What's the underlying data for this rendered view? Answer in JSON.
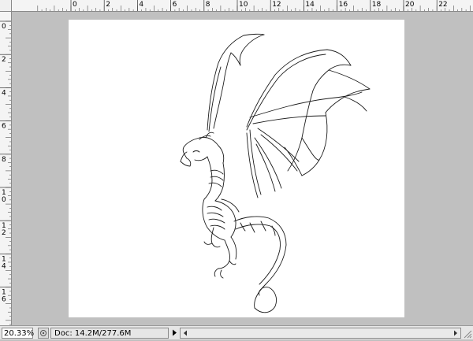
{
  "rulers": {
    "top_labels": [
      "0",
      "2",
      "4",
      "6",
      "8",
      "10",
      "12",
      "14",
      "16",
      "18",
      "20",
      "22"
    ],
    "left_labels": [
      "0",
      "2",
      "4",
      "6",
      "8",
      "10",
      "12",
      "14",
      "16"
    ]
  },
  "status_bar": {
    "zoom": "20.33%",
    "doc_info": "Doc: 14.2M/277.6M"
  },
  "icons": {
    "status_menu_arrow": "play-right-icon",
    "scroll_left": "scroll-left-icon",
    "scroll_right": "scroll-right-icon"
  },
  "colors": {
    "workspace": "#c0c0c0",
    "document": "#ffffff",
    "sketch": "#1a1a1a"
  }
}
